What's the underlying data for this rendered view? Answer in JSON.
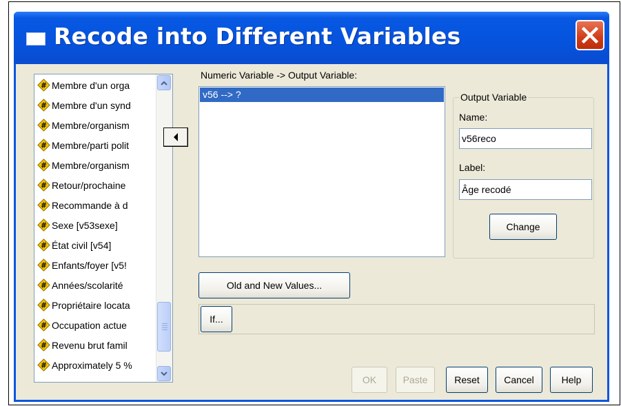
{
  "window": {
    "title": "Recode into Different Variables"
  },
  "variables": [
    "Membre d'un orga",
    "Membre d'un synd",
    "Membre/organism",
    "Membre/parti polit",
    "Membre/organism",
    "Retour/prochaine",
    "Recommande à d",
    "Sexe [v53sexe]",
    "État civil [v54]",
    "Enfants/foyer [v5!",
    "Années/scolarité",
    "Propriétaire locata",
    "Occupation actue",
    "Revenu brut famil",
    "Approximately 5 %"
  ],
  "mapping": {
    "label": "Numeric Variable -> Output Variable:",
    "rows": [
      "v56 --> ?"
    ]
  },
  "output": {
    "group_title": "Output Variable",
    "name_label": "Name:",
    "name_value": "v56reco",
    "label_label": "Label:",
    "label_value": "Âge recodé",
    "change_button": "Change"
  },
  "buttons": {
    "old_new": "Old and New Values...",
    "if": "If...",
    "ok": "OK",
    "paste": "Paste",
    "reset": "Reset",
    "cancel": "Cancel",
    "help": "Help"
  },
  "colors": {
    "title_bar": "#0553dd",
    "selection": "#316ac5",
    "dialog_bg": "#ece9d8",
    "close_button": "#d13b17",
    "variable_icon": "#f5c400"
  },
  "icons": {
    "variable": "numeric-variable-icon",
    "close": "close-icon",
    "move": "left-arrow-icon"
  }
}
